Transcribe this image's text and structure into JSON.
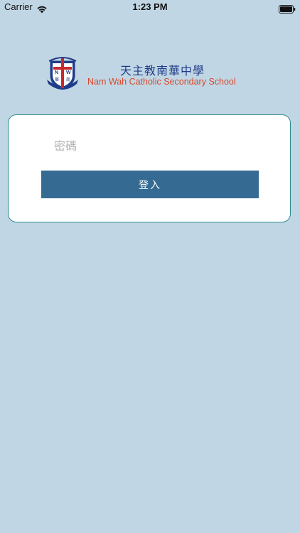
{
  "status_bar": {
    "carrier": "Carrier",
    "time": "1:23 PM",
    "wifi_icon": "wifi-icon",
    "battery_icon": "battery-icon"
  },
  "header": {
    "crest_icon": "school-crest-icon",
    "crest_letters": "N W",
    "crest_characters": "華 南",
    "school_name_zh": "天主教南華中學",
    "school_name_en": "Nam Wah Catholic Secondary School"
  },
  "login": {
    "password_placeholder": "密碼",
    "password_value": "",
    "login_label": "登入"
  },
  "colors": {
    "background": "#c1d6e4",
    "card_border": "#2c8c8c",
    "button": "#356b93",
    "title_zh": "#1f3c88",
    "title_en": "#d6472b"
  }
}
